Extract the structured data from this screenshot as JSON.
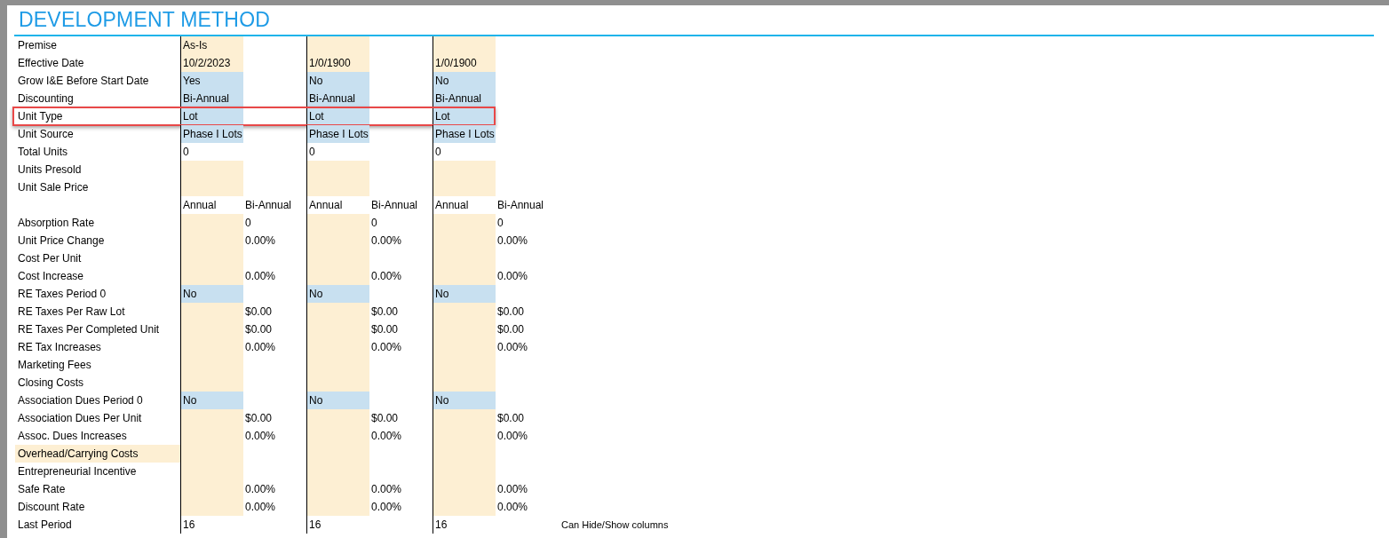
{
  "title": "DEVELOPMENT METHOD",
  "rows": [
    {
      "label": "Premise",
      "label_highlighted": false,
      "outlined": false,
      "cells": [
        {
          "kind": "input",
          "text": "As-Is"
        },
        {
          "kind": "plain"
        },
        {
          "kind": "input"
        },
        {
          "kind": "plain"
        },
        {
          "kind": "input"
        },
        {
          "kind": "plain"
        }
      ]
    },
    {
      "label": "Effective Date",
      "label_highlighted": false,
      "outlined": false,
      "cells": [
        {
          "kind": "input",
          "text": "10/2/2023"
        },
        {
          "kind": "plain"
        },
        {
          "kind": "input",
          "text": "1/0/1900"
        },
        {
          "kind": "plain"
        },
        {
          "kind": "input",
          "text": "1/0/1900"
        },
        {
          "kind": "plain"
        }
      ]
    },
    {
      "label": "Grow I&E Before Start Date",
      "label_highlighted": false,
      "outlined": false,
      "cells": [
        {
          "kind": "dropdown",
          "text": "Yes"
        },
        {
          "kind": "plain"
        },
        {
          "kind": "dropdown",
          "text": "No"
        },
        {
          "kind": "plain"
        },
        {
          "kind": "dropdown",
          "text": "No"
        },
        {
          "kind": "plain"
        }
      ]
    },
    {
      "label": "Discounting",
      "label_highlighted": false,
      "outlined": false,
      "cells": [
        {
          "kind": "dropdown",
          "text": "Bi-Annual"
        },
        {
          "kind": "plain"
        },
        {
          "kind": "dropdown",
          "text": "Bi-Annual"
        },
        {
          "kind": "plain"
        },
        {
          "kind": "dropdown",
          "text": "Bi-Annual"
        },
        {
          "kind": "plain"
        }
      ]
    },
    {
      "label": "Unit Type",
      "label_highlighted": false,
      "outlined": true,
      "cells": [
        {
          "kind": "dropdown",
          "text": "Lot"
        },
        {
          "kind": "plain"
        },
        {
          "kind": "dropdown",
          "text": "Lot"
        },
        {
          "kind": "plain"
        },
        {
          "kind": "dropdown",
          "text": "Lot"
        },
        {
          "kind": "plain"
        }
      ]
    },
    {
      "label": "Unit Source",
      "label_highlighted": false,
      "outlined": false,
      "cells": [
        {
          "kind": "dropdown",
          "text": "Phase I Lots"
        },
        {
          "kind": "plain"
        },
        {
          "kind": "dropdown",
          "text": "Phase I Lots"
        },
        {
          "kind": "plain"
        },
        {
          "kind": "dropdown",
          "text": "Phase I Lots"
        },
        {
          "kind": "plain"
        }
      ]
    },
    {
      "label": "Total Units",
      "label_highlighted": false,
      "outlined": false,
      "cells": [
        {
          "kind": "plain",
          "text": "0"
        },
        {
          "kind": "plain"
        },
        {
          "kind": "plain",
          "text": "0"
        },
        {
          "kind": "plain"
        },
        {
          "kind": "plain",
          "text": "0"
        },
        {
          "kind": "plain"
        }
      ]
    },
    {
      "label": "Units Presold",
      "label_highlighted": false,
      "outlined": false,
      "cells": [
        {
          "kind": "input"
        },
        {
          "kind": "plain"
        },
        {
          "kind": "input"
        },
        {
          "kind": "plain"
        },
        {
          "kind": "input"
        },
        {
          "kind": "plain"
        }
      ]
    },
    {
      "label": "Unit Sale Price",
      "label_highlighted": false,
      "outlined": false,
      "cells": [
        {
          "kind": "input"
        },
        {
          "kind": "plain"
        },
        {
          "kind": "input"
        },
        {
          "kind": "plain"
        },
        {
          "kind": "input"
        },
        {
          "kind": "plain"
        }
      ]
    },
    {
      "label_highlighted": false,
      "outlined": false,
      "cells": [
        {
          "kind": "plain",
          "text": "Annual"
        },
        {
          "kind": "plain",
          "text": "Bi-Annual"
        },
        {
          "kind": "plain",
          "text": "Annual"
        },
        {
          "kind": "plain",
          "text": "Bi-Annual"
        },
        {
          "kind": "plain",
          "text": "Annual"
        },
        {
          "kind": "plain",
          "text": "Bi-Annual"
        }
      ]
    },
    {
      "label": "Absorption Rate",
      "label_highlighted": false,
      "outlined": false,
      "cells": [
        {
          "kind": "input"
        },
        {
          "kind": "plain",
          "text": "0"
        },
        {
          "kind": "input"
        },
        {
          "kind": "plain",
          "text": "0"
        },
        {
          "kind": "input"
        },
        {
          "kind": "plain",
          "text": "0"
        }
      ]
    },
    {
      "label": "Unit Price Change",
      "label_highlighted": false,
      "outlined": false,
      "cells": [
        {
          "kind": "input"
        },
        {
          "kind": "plain",
          "text": "0.00%"
        },
        {
          "kind": "input"
        },
        {
          "kind": "plain",
          "text": "0.00%"
        },
        {
          "kind": "input"
        },
        {
          "kind": "plain",
          "text": "0.00%"
        }
      ]
    },
    {
      "label": "Cost Per Unit",
      "label_highlighted": false,
      "outlined": false,
      "cells": [
        {
          "kind": "input"
        },
        {
          "kind": "plain"
        },
        {
          "kind": "input"
        },
        {
          "kind": "plain"
        },
        {
          "kind": "input"
        },
        {
          "kind": "plain"
        }
      ]
    },
    {
      "label": "Cost Increase",
      "label_highlighted": false,
      "outlined": false,
      "cells": [
        {
          "kind": "input"
        },
        {
          "kind": "plain",
          "text": "0.00%"
        },
        {
          "kind": "input"
        },
        {
          "kind": "plain",
          "text": "0.00%"
        },
        {
          "kind": "input"
        },
        {
          "kind": "plain",
          "text": "0.00%"
        }
      ]
    },
    {
      "label": "RE Taxes Period 0",
      "label_highlighted": false,
      "outlined": false,
      "cells": [
        {
          "kind": "dropdown",
          "text": "No"
        },
        {
          "kind": "plain"
        },
        {
          "kind": "dropdown",
          "text": "No"
        },
        {
          "kind": "plain"
        },
        {
          "kind": "dropdown",
          "text": "No"
        },
        {
          "kind": "plain"
        }
      ]
    },
    {
      "label": "RE Taxes Per Raw Lot",
      "label_highlighted": false,
      "outlined": false,
      "cells": [
        {
          "kind": "input"
        },
        {
          "kind": "plain",
          "text": "$0.00"
        },
        {
          "kind": "input"
        },
        {
          "kind": "plain",
          "text": "$0.00"
        },
        {
          "kind": "input"
        },
        {
          "kind": "plain",
          "text": "$0.00"
        }
      ]
    },
    {
      "label": "RE Taxes Per Completed Unit",
      "label_highlighted": false,
      "outlined": false,
      "cells": [
        {
          "kind": "input"
        },
        {
          "kind": "plain",
          "text": "$0.00"
        },
        {
          "kind": "input"
        },
        {
          "kind": "plain",
          "text": "$0.00"
        },
        {
          "kind": "input"
        },
        {
          "kind": "plain",
          "text": "$0.00"
        }
      ]
    },
    {
      "label": "RE Tax Increases",
      "label_highlighted": false,
      "outlined": false,
      "cells": [
        {
          "kind": "input"
        },
        {
          "kind": "plain",
          "text": "0.00%"
        },
        {
          "kind": "input"
        },
        {
          "kind": "plain",
          "text": "0.00%"
        },
        {
          "kind": "input"
        },
        {
          "kind": "plain",
          "text": "0.00%"
        }
      ]
    },
    {
      "label": "Marketing Fees",
      "label_highlighted": false,
      "outlined": false,
      "cells": [
        {
          "kind": "input"
        },
        {
          "kind": "plain"
        },
        {
          "kind": "input"
        },
        {
          "kind": "plain"
        },
        {
          "kind": "input"
        },
        {
          "kind": "plain"
        }
      ]
    },
    {
      "label": "Closing Costs",
      "label_highlighted": false,
      "outlined": false,
      "cells": [
        {
          "kind": "input"
        },
        {
          "kind": "plain"
        },
        {
          "kind": "input"
        },
        {
          "kind": "plain"
        },
        {
          "kind": "input"
        },
        {
          "kind": "plain"
        }
      ]
    },
    {
      "label": "Association Dues Period 0",
      "label_highlighted": false,
      "outlined": false,
      "cells": [
        {
          "kind": "dropdown",
          "text": "No"
        },
        {
          "kind": "plain"
        },
        {
          "kind": "dropdown",
          "text": "No"
        },
        {
          "kind": "plain"
        },
        {
          "kind": "dropdown",
          "text": "No"
        },
        {
          "kind": "plain"
        }
      ]
    },
    {
      "label": "Association Dues Per Unit",
      "label_highlighted": false,
      "outlined": false,
      "cells": [
        {
          "kind": "input"
        },
        {
          "kind": "plain",
          "text": "$0.00"
        },
        {
          "kind": "input"
        },
        {
          "kind": "plain",
          "text": "$0.00"
        },
        {
          "kind": "input"
        },
        {
          "kind": "plain",
          "text": "$0.00"
        }
      ]
    },
    {
      "label": "Assoc. Dues Increases",
      "label_highlighted": false,
      "outlined": false,
      "cells": [
        {
          "kind": "input"
        },
        {
          "kind": "plain",
          "text": "0.00%"
        },
        {
          "kind": "input"
        },
        {
          "kind": "plain",
          "text": "0.00%"
        },
        {
          "kind": "input"
        },
        {
          "kind": "plain",
          "text": "0.00%"
        }
      ]
    },
    {
      "label": "Overhead/Carrying Costs",
      "label_highlighted": true,
      "outlined": false,
      "cells": [
        {
          "kind": "input"
        },
        {
          "kind": "plain"
        },
        {
          "kind": "input"
        },
        {
          "kind": "plain"
        },
        {
          "kind": "input"
        },
        {
          "kind": "plain"
        }
      ]
    },
    {
      "label": "Entrepreneurial Incentive",
      "label_highlighted": false,
      "outlined": false,
      "cells": [
        {
          "kind": "input"
        },
        {
          "kind": "plain"
        },
        {
          "kind": "input"
        },
        {
          "kind": "plain"
        },
        {
          "kind": "input"
        },
        {
          "kind": "plain"
        }
      ]
    },
    {
      "label": "Safe Rate",
      "label_highlighted": false,
      "outlined": false,
      "cells": [
        {
          "kind": "input"
        },
        {
          "kind": "plain",
          "text": "0.00%"
        },
        {
          "kind": "input"
        },
        {
          "kind": "plain",
          "text": "0.00%"
        },
        {
          "kind": "input"
        },
        {
          "kind": "plain",
          "text": "0.00%"
        }
      ]
    },
    {
      "label": "Discount Rate",
      "label_highlighted": false,
      "outlined": false,
      "cells": [
        {
          "kind": "input"
        },
        {
          "kind": "plain",
          "text": "0.00%"
        },
        {
          "kind": "input"
        },
        {
          "kind": "plain",
          "text": "0.00%"
        },
        {
          "kind": "input"
        },
        {
          "kind": "plain",
          "text": "0.00%"
        }
      ]
    },
    {
      "label": "Last Period",
      "label_highlighted": false,
      "outlined": false,
      "note": "Can Hide/Show columns",
      "cells": [
        {
          "kind": "plain",
          "text": "16"
        },
        {
          "kind": "plain"
        },
        {
          "kind": "plain",
          "text": "16"
        },
        {
          "kind": "plain"
        },
        {
          "kind": "plain",
          "text": "16"
        },
        {
          "kind": "plain"
        }
      ]
    }
  ]
}
